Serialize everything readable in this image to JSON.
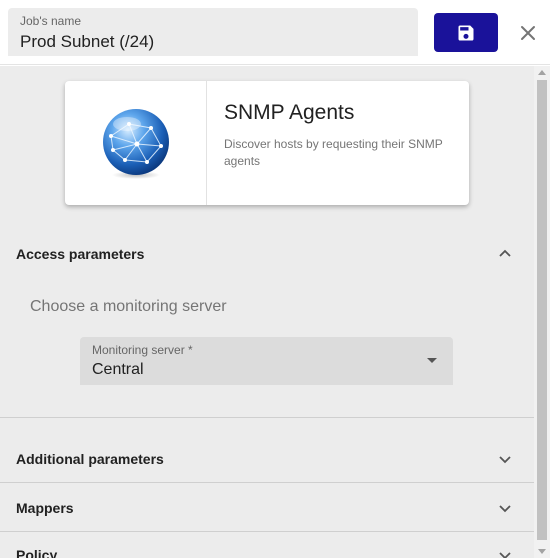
{
  "header": {
    "name_label": "Job's name",
    "name_value": "Prod Subnet (/24)",
    "save_icon": "floppy-disk-icon",
    "close_icon": "close-icon"
  },
  "card": {
    "icon": "globe-icon",
    "title": "SNMP Agents",
    "description": "Discover hosts by requesting their SNMP agents"
  },
  "sections": {
    "access": {
      "title": "Access parameters",
      "expanded": true,
      "hint": "Choose a monitoring server",
      "server_label": "Monitoring server *",
      "server_value": "Central"
    },
    "additional": {
      "title": "Additional parameters",
      "expanded": false
    },
    "mappers": {
      "title": "Mappers",
      "expanded": false
    },
    "policy": {
      "title": "Policy",
      "expanded": false
    }
  },
  "colors": {
    "save_button": "#1a129a",
    "panel_background": "#ececec"
  }
}
